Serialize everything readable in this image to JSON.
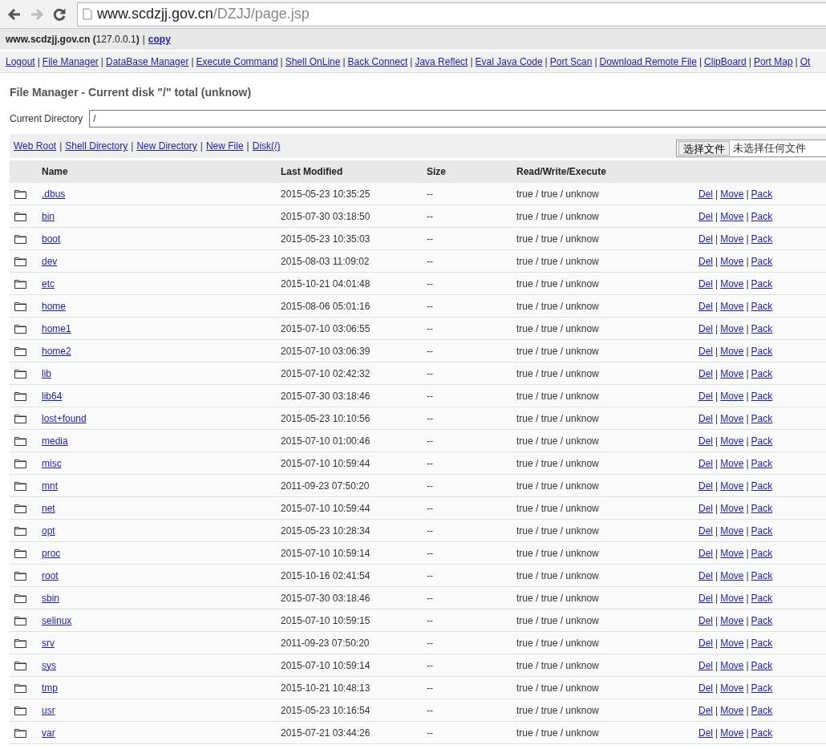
{
  "browser": {
    "back_disabled": false,
    "forward_disabled": true,
    "url_host": "www.scdzjj.gov.cn",
    "url_path": "/DZJJ/page.jsp"
  },
  "host_line": {
    "text": "**www.scdzjj.gov.cn (**127.0.0.1**)**",
    "separator": "|",
    "copy": "copy"
  },
  "nav": {
    "separator": "|",
    "items": [
      "Logout",
      "File Manager",
      "DataBase Manager",
      "Execute Command",
      "Shell OnLine",
      "Back Connect",
      "Java Reflect",
      "Eval Java Code",
      "Port Scan",
      "Download Remote File",
      "ClipBoard",
      "Port Map",
      "Ot"
    ]
  },
  "title": "File Manager - Current disk \"/\" total (unknow)",
  "current_directory": {
    "label": "Current Directory",
    "value": "/"
  },
  "toolbar": {
    "separator": "|",
    "links": [
      "Web Root",
      "Shell Directory",
      "New Directory",
      "New File",
      "Disk(/)"
    ],
    "file_button": "选择文件",
    "file_status": "未选择任何文件"
  },
  "table": {
    "action_separator": "|",
    "columns": [
      "Name",
      "Last Modified",
      "Size",
      "Read/Write/Execute"
    ],
    "rows": [
      {
        "name": ".dbus",
        "modified": "2015-05-23 10:35:25",
        "size": "--",
        "rwx": "true / true / unknow",
        "actions": [
          "Del",
          "Move",
          "Pack"
        ]
      },
      {
        "name": "bin",
        "modified": "2015-07-30 03:18:50",
        "size": "--",
        "rwx": "true / true / unknow",
        "actions": [
          "Del",
          "Move",
          "Pack"
        ]
      },
      {
        "name": "boot",
        "modified": "2015-05-23 10:35:03",
        "size": "--",
        "rwx": "true / true / unknow",
        "actions": [
          "Del",
          "Move",
          "Pack"
        ]
      },
      {
        "name": "dev",
        "modified": "2015-08-03 11:09:02",
        "size": "--",
        "rwx": "true / true / unknow",
        "actions": [
          "Del",
          "Move",
          "Pack"
        ]
      },
      {
        "name": "etc",
        "modified": "2015-10-21 04:01:48",
        "size": "--",
        "rwx": "true / true / unknow",
        "actions": [
          "Del",
          "Move",
          "Pack"
        ]
      },
      {
        "name": "home",
        "modified": "2015-08-06 05:01:16",
        "size": "--",
        "rwx": "true / true / unknow",
        "actions": [
          "Del",
          "Move",
          "Pack"
        ]
      },
      {
        "name": "home1",
        "modified": "2015-07-10 03:06:55",
        "size": "--",
        "rwx": "true / true / unknow",
        "actions": [
          "Del",
          "Move",
          "Pack"
        ]
      },
      {
        "name": "home2",
        "modified": "2015-07-10 03:06:39",
        "size": "--",
        "rwx": "true / true / unknow",
        "actions": [
          "Del",
          "Move",
          "Pack"
        ]
      },
      {
        "name": "lib",
        "modified": "2015-07-10 02:42:32",
        "size": "--",
        "rwx": "true / true / unknow",
        "actions": [
          "Del",
          "Move",
          "Pack"
        ]
      },
      {
        "name": "lib64",
        "modified": "2015-07-30 03:18:46",
        "size": "--",
        "rwx": "true / true / unknow",
        "actions": [
          "Del",
          "Move",
          "Pack"
        ]
      },
      {
        "name": "lost+found",
        "modified": "2015-05-23 10:10:56",
        "size": "--",
        "rwx": "true / true / unknow",
        "actions": [
          "Del",
          "Move",
          "Pack"
        ]
      },
      {
        "name": "media",
        "modified": "2015-07-10 01:00:46",
        "size": "--",
        "rwx": "true / true / unknow",
        "actions": [
          "Del",
          "Move",
          "Pack"
        ]
      },
      {
        "name": "misc",
        "modified": "2015-07-10 10:59:44",
        "size": "--",
        "rwx": "true / true / unknow",
        "actions": [
          "Del",
          "Move",
          "Pack"
        ]
      },
      {
        "name": "mnt",
        "modified": "2011-09-23 07:50:20",
        "size": "--",
        "rwx": "true / true / unknow",
        "actions": [
          "Del",
          "Move",
          "Pack"
        ]
      },
      {
        "name": "net",
        "modified": "2015-07-10 10:59:44",
        "size": "--",
        "rwx": "true / true / unknow",
        "actions": [
          "Del",
          "Move",
          "Pack"
        ]
      },
      {
        "name": "opt",
        "modified": "2015-05-23 10:28:34",
        "size": "--",
        "rwx": "true / true / unknow",
        "actions": [
          "Del",
          "Move",
          "Pack"
        ]
      },
      {
        "name": "proc",
        "modified": "2015-07-10 10:59:14",
        "size": "--",
        "rwx": "true / true / unknow",
        "actions": [
          "Del",
          "Move",
          "Pack"
        ]
      },
      {
        "name": "root",
        "modified": "2015-10-16 02:41:54",
        "size": "--",
        "rwx": "true / true / unknow",
        "actions": [
          "Del",
          "Move",
          "Pack"
        ]
      },
      {
        "name": "sbin",
        "modified": "2015-07-30 03:18:46",
        "size": "--",
        "rwx": "true / true / unknow",
        "actions": [
          "Del",
          "Move",
          "Pack"
        ]
      },
      {
        "name": "selinux",
        "modified": "2015-07-10 10:59:15",
        "size": "--",
        "rwx": "true / true / unknow",
        "actions": [
          "Del",
          "Move",
          "Pack"
        ]
      },
      {
        "name": "srv",
        "modified": "2011-09-23 07:50:20",
        "size": "--",
        "rwx": "true / true / unknow",
        "actions": [
          "Del",
          "Move",
          "Pack"
        ]
      },
      {
        "name": "sys",
        "modified": "2015-07-10 10:59:14",
        "size": "--",
        "rwx": "true / true / unknow",
        "actions": [
          "Del",
          "Move",
          "Pack"
        ]
      },
      {
        "name": "tmp",
        "modified": "2015-10-21 10:48:13",
        "size": "--",
        "rwx": "true / true / unknow",
        "actions": [
          "Del",
          "Move",
          "Pack"
        ]
      },
      {
        "name": "usr",
        "modified": "2015-05-23 10:16:54",
        "size": "--",
        "rwx": "true / true / unknow",
        "actions": [
          "Del",
          "Move",
          "Pack"
        ]
      },
      {
        "name": "var",
        "modified": "2015-07-21 03:44:26",
        "size": "--",
        "rwx": "true / true / unknow",
        "actions": [
          "Del",
          "Move",
          "Pack"
        ]
      }
    ]
  }
}
